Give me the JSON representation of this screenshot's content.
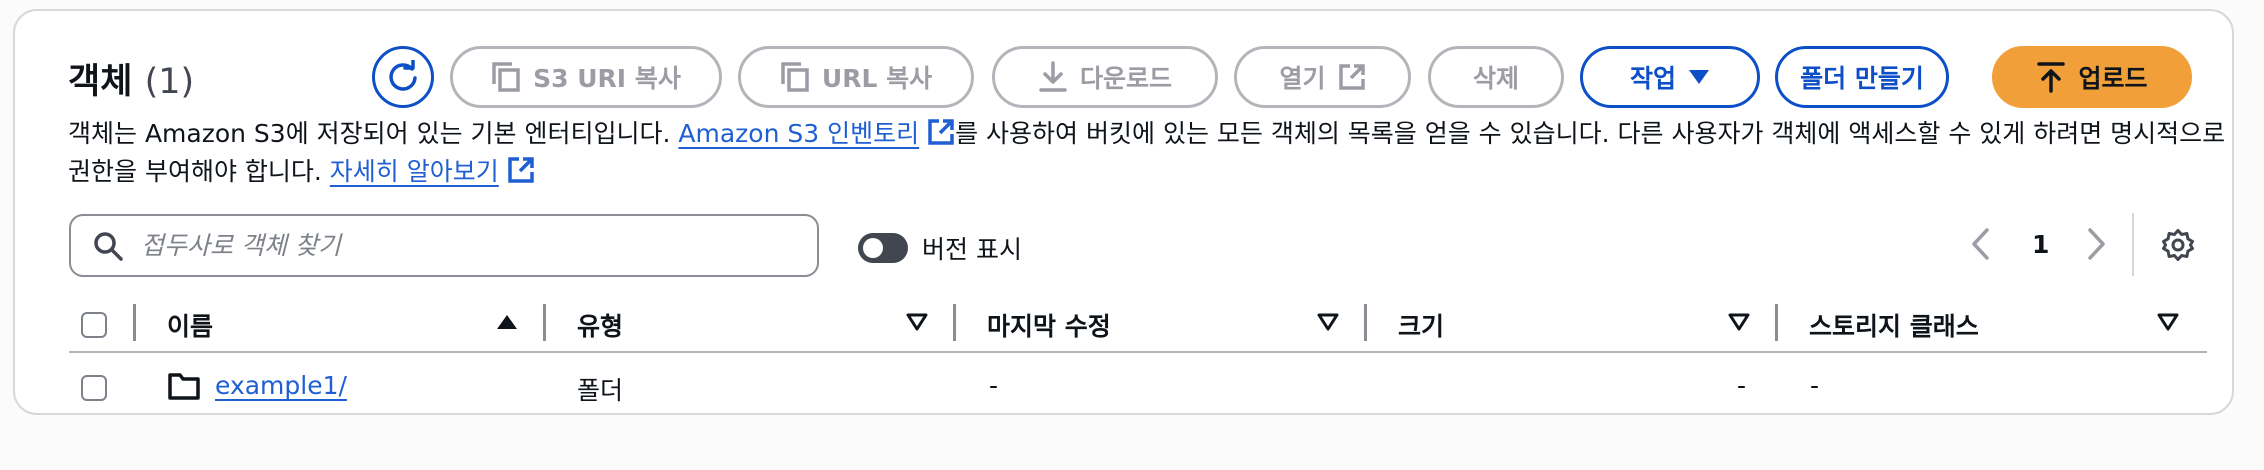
{
  "header": {
    "title": "객체",
    "count": "(1)"
  },
  "toolbar": {
    "copy_s3_uri": "S3 URI 복사",
    "copy_url": "URL 복사",
    "download": "다운로드",
    "open": "열기",
    "delete": "삭제",
    "actions": "작업",
    "create_folder": "폴더 만들기",
    "upload": "업로드"
  },
  "description": {
    "part1": "객체는 Amazon S3에 저장되어 있는 기본 엔터티입니다. ",
    "inventory_link": "Amazon S3 인벤토리",
    "part2": "를 사용하여 버킷에 있는 모든 객체의 목록을 얻을 수 있습니다. 다른 사용자가 객체에 액세스할 수 있게 하려면 명시적으로 권한을 부여해야 합니다. ",
    "learn_more_link": "자세히 알아보기"
  },
  "search": {
    "placeholder": "접두사로 객체 찾기",
    "value": ""
  },
  "version_toggle": {
    "label": "버전 표시",
    "on": false
  },
  "pagination": {
    "current_page": "1"
  },
  "table": {
    "columns": [
      "이름",
      "유형",
      "마지막 수정",
      "크기",
      "스토리지 클래스"
    ],
    "rows": [
      {
        "name": "example1/",
        "type": "폴더",
        "last_modified": "-",
        "size": "-",
        "storage_class": "-"
      }
    ]
  },
  "colors": {
    "primary_blue": "#0d4fc7",
    "link_blue": "#1f5fd2",
    "upload_orange": "#f19f38",
    "disabled_gray": "#9c9ca4"
  },
  "icons": [
    "refresh-icon",
    "copy-icon",
    "download-icon",
    "external-link-icon",
    "caret-down-icon",
    "upload-icon",
    "search-icon",
    "chevron-left-icon",
    "chevron-right-icon",
    "settings-gear-icon",
    "sort-ascending-icon",
    "sort-icon",
    "folder-icon"
  ]
}
